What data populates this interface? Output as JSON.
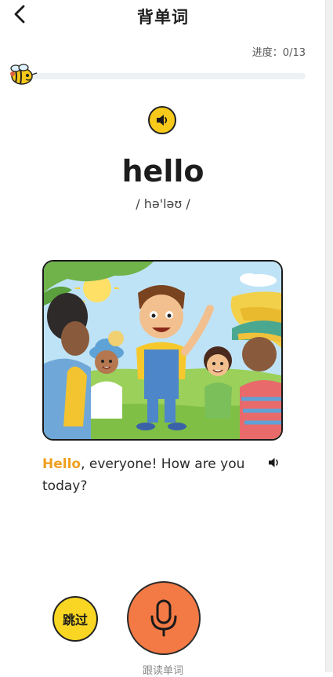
{
  "header": {
    "title": "背单词",
    "back_icon": "chevron-left-icon"
  },
  "progress": {
    "label": "进度：0/13",
    "current": 0,
    "total": 13,
    "mascot_icon": "bee-mascot-icon"
  },
  "word": {
    "text": "hello",
    "phonetic": "/ hə'ləʊ /",
    "audio_icon": "speaker-icon"
  },
  "example": {
    "highlight": "Hello",
    "rest": ", everyone! How are you today?",
    "audio_icon": "speaker-icon"
  },
  "actions": {
    "skip_label": "跳过",
    "mic_label": "跟读单词",
    "mic_icon": "microphone-icon"
  },
  "colors": {
    "accent_yellow": "#f7c91a",
    "mic_orange": "#f47a45",
    "highlight_orange": "#f0a020"
  }
}
